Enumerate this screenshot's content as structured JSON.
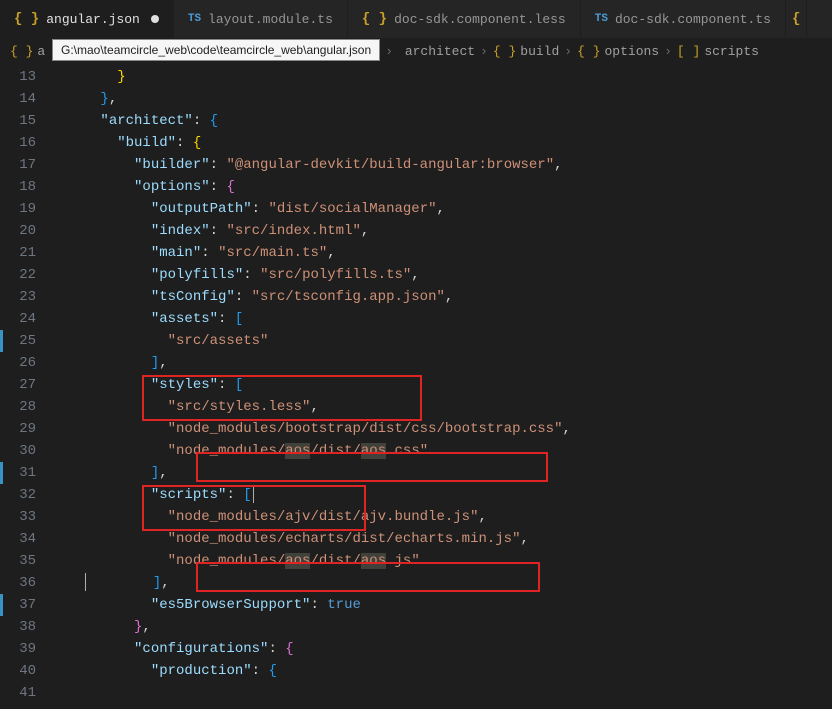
{
  "tabs": [
    {
      "label": "angular.json",
      "icon": "braces",
      "active": true,
      "modified": true
    },
    {
      "label": "layout.module.ts",
      "icon": "ts",
      "active": false,
      "modified": false
    },
    {
      "label": "doc-sdk.component.less",
      "icon": "braces",
      "active": false,
      "modified": false
    },
    {
      "label": "doc-sdk.component.ts",
      "icon": "ts",
      "active": false,
      "modified": false
    }
  ],
  "tooltip": "G:\\mao\\teamcircle_web\\code\\teamcircle_web\\angular.json",
  "breadcrumb": {
    "file_label": "a",
    "parts": [
      "architect",
      "build",
      "options",
      "scripts"
    ]
  },
  "line_start": 13,
  "line_end": 41,
  "code": {
    "l13": "        }",
    "l14": "      },",
    "l15_key": "\"architect\"",
    "l16_key": "\"build\"",
    "l17_key": "\"builder\"",
    "l17_val": "\"@angular-devkit/build-angular:browser\"",
    "l18_key": "\"options\"",
    "l19_key": "\"outputPath\"",
    "l19_val": "\"dist/socialManager\"",
    "l20_key": "\"index\"",
    "l20_val": "\"src/index.html\"",
    "l21_key": "\"main\"",
    "l21_val": "\"src/main.ts\"",
    "l22_key": "\"polyfills\"",
    "l22_val": "\"src/polyfills.ts\"",
    "l23_key": "\"tsConfig\"",
    "l23_val": "\"src/tsconfig.app.json\"",
    "l24_key": "\"assets\"",
    "l25_val": "\"src/assets\"",
    "l27_key": "\"styles\"",
    "l28_val": "\"src/styles.less\"",
    "l29_val": "\"node_modules/bootstrap/dist/css/bootstrap.css\"",
    "l30_a": "\"node_modules/",
    "l30_b": "aos",
    "l30_c": "/dist/",
    "l30_d": "aos",
    "l30_e": ".css\"",
    "l32_key": "\"scripts\"",
    "l33_val": "\"node_modules/ajv/dist/ajv.bundle.js\"",
    "l34_val": "\"node_modules/echarts/dist/echarts.min.js\"",
    "l35_a": "\"node_modules/",
    "l35_b": "aos",
    "l35_c": "/dist/",
    "l35_d": "aos",
    "l35_e": ".js\"",
    "l37_key": "\"es5BrowserSupport\"",
    "l37_val": "true",
    "l39_key": "\"configurations\"",
    "l40_key": "\"production\""
  },
  "highlight": "aos"
}
